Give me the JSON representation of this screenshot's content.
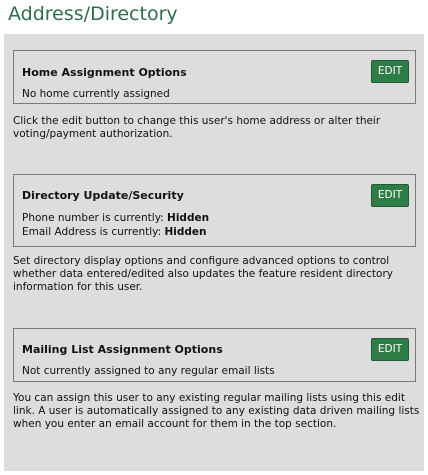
{
  "page": {
    "title": "Address/Directory"
  },
  "home": {
    "title": "Home Assignment Options",
    "status": "No home currently assigned",
    "edit_label": "EDIT",
    "description": "Click the edit button to change this user's home address or alter their voting/payment authorization."
  },
  "directory": {
    "title": "Directory Update/Security",
    "phone_label": "Phone number is currently:",
    "phone_value": "Hidden",
    "email_label": "Email Address is currently:",
    "email_value": "Hidden",
    "edit_label": "EDIT",
    "description": "Set directory display options and configure advanced options to control whether data entered/edited also updates the feature resident directory information for this user."
  },
  "mailing": {
    "title": "Mailing List Assignment Options",
    "status": "Not currently assigned to any regular email lists",
    "edit_label": "EDIT",
    "description": "You can assign this user to any existing regular mailing lists using this edit link. A user is automatically assigned to any existing data driven mailing lists when you enter an email account for them in the top section."
  },
  "colors": {
    "heading": "#2d6e4e",
    "button": "#2e7d46",
    "panel": "#dddddd"
  }
}
